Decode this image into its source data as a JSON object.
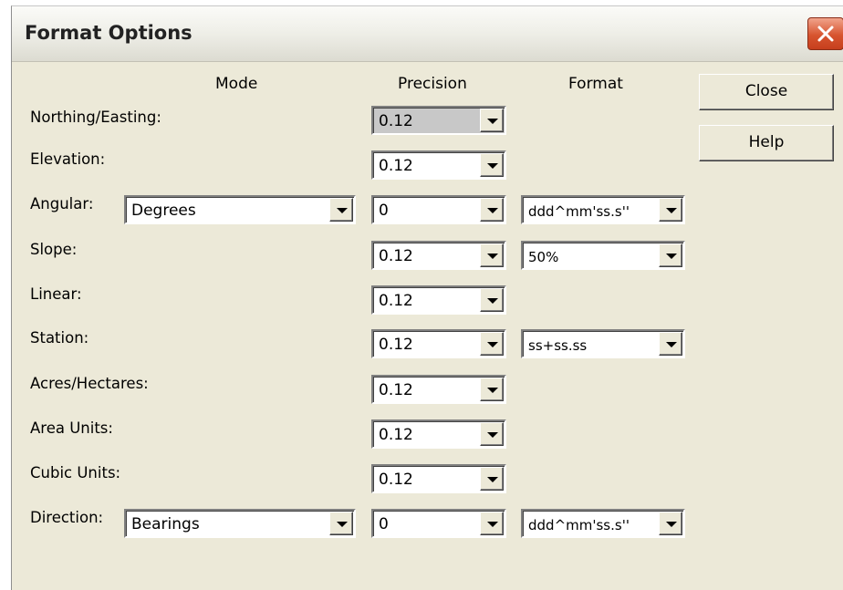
{
  "window": {
    "title": "Format Options"
  },
  "headers": {
    "mode": "Mode",
    "precision": "Precision",
    "format": "Format"
  },
  "buttons": {
    "close": "Close",
    "help": "Help"
  },
  "rows": [
    {
      "label": "Northing/Easting:",
      "precision": "0.12"
    },
    {
      "label": "Elevation:",
      "precision": "0.12"
    },
    {
      "label": "Angular:",
      "mode": "Degrees",
      "precision": "0",
      "format": "ddd^mm'ss.s''"
    },
    {
      "label": "Slope:",
      "precision": "0.12",
      "format": "50%"
    },
    {
      "label": "Linear:",
      "precision": "0.12"
    },
    {
      "label": "Station:",
      "precision": "0.12",
      "format": "ss+ss.ss"
    },
    {
      "label": "Acres/Hectares:",
      "precision": "0.12"
    },
    {
      "label": "Area Units:",
      "precision": "0.12"
    },
    {
      "label": "Cubic Units:",
      "precision": "0.12"
    },
    {
      "label": "Direction:",
      "mode": "Bearings",
      "precision": "0",
      "format": "ddd^mm'ss.s''"
    }
  ]
}
